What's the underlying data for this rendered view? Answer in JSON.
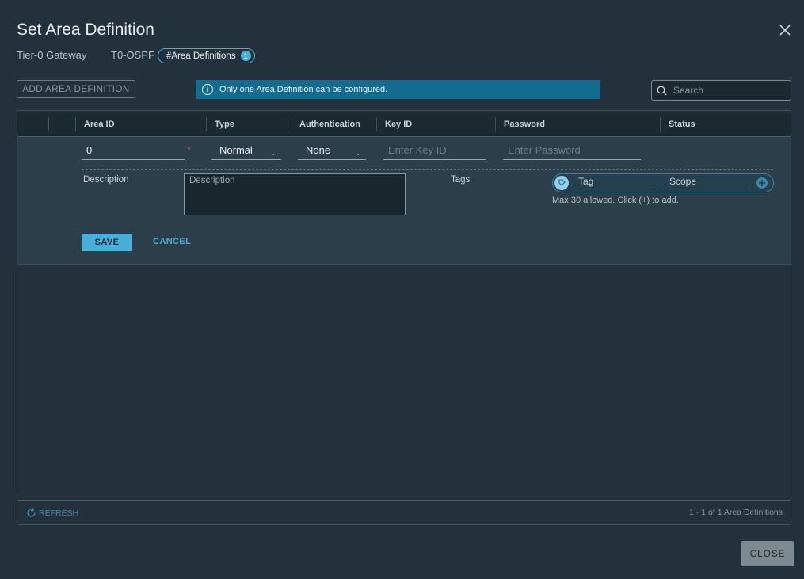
{
  "dialog": {
    "title": "Set Area Definition",
    "close_label": "CLOSE"
  },
  "context": {
    "gateway_label": "Tier-0 Gateway",
    "gateway_name": "T0-OSPF",
    "badge_label": "#Area Definitions",
    "badge_count": "1"
  },
  "toolbar": {
    "add_label": "ADD AREA DEFINITION",
    "info_message": "Only one Area Definition can be configured.",
    "search_placeholder": "Search"
  },
  "table": {
    "columns": [
      "Area ID",
      "Type",
      "Authentication",
      "Key ID",
      "Password",
      "Status"
    ],
    "edit_row": {
      "area_id": "0",
      "type": "Normal",
      "authentication": "None",
      "key_id_placeholder": "Enter Key ID",
      "password_placeholder": "Enter Password",
      "description_label": "Description",
      "description_placeholder": "Description",
      "tags_label": "Tags",
      "tag_placeholder": "Tag",
      "scope_placeholder": "Scope",
      "tags_hint": "Max 30 allowed. Click (+) to add.",
      "save_label": "SAVE",
      "cancel_label": "CANCEL"
    },
    "footer": {
      "refresh_label": "REFRESH",
      "count_text": "1 - 1 of 1 Area Definitions"
    }
  },
  "colors": {
    "accent": "#49afd9",
    "info_bg": "#136b8f",
    "required": "#e0465a"
  }
}
